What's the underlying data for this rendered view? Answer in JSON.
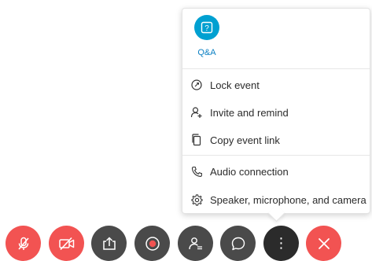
{
  "menu": {
    "qa": {
      "label": "Q&A",
      "glyph": "?"
    },
    "items": [
      {
        "label": "Lock event",
        "icon": "lock-icon"
      },
      {
        "label": "Invite and remind",
        "icon": "add-person-icon"
      },
      {
        "label": "Copy event link",
        "icon": "copy-icon"
      },
      {
        "label": "Audio connection",
        "icon": "phone-icon"
      },
      {
        "label": "Speaker, microphone, and camera",
        "icon": "settings-gear-icon"
      }
    ]
  },
  "toolbar": {
    "more_glyph": "⋮",
    "buttons": [
      {
        "name": "mute-button",
        "icon": "microphone-muted-icon",
        "color": "#f25352"
      },
      {
        "name": "stop-video-button",
        "icon": "video-off-icon",
        "color": "#f25352"
      },
      {
        "name": "share-button",
        "icon": "share-icon",
        "color": "#4a4a4a"
      },
      {
        "name": "record-button",
        "icon": "record-icon",
        "color": "#4a4a4a"
      },
      {
        "name": "participants-button",
        "icon": "participants-icon",
        "color": "#4a4a4a"
      },
      {
        "name": "chat-button",
        "icon": "chat-icon",
        "color": "#4a4a4a"
      },
      {
        "name": "more-options-button",
        "icon": "more-vertical-icon",
        "color": "#2b2b2b"
      },
      {
        "name": "leave-button",
        "icon": "close-icon",
        "color": "#f25352"
      }
    ]
  },
  "colors": {
    "accent": "#0a7fc2",
    "qa_circle": "#00a0d1",
    "danger": "#f25352",
    "dark_button": "#4a4a4a",
    "active_button": "#2b2b2b"
  }
}
